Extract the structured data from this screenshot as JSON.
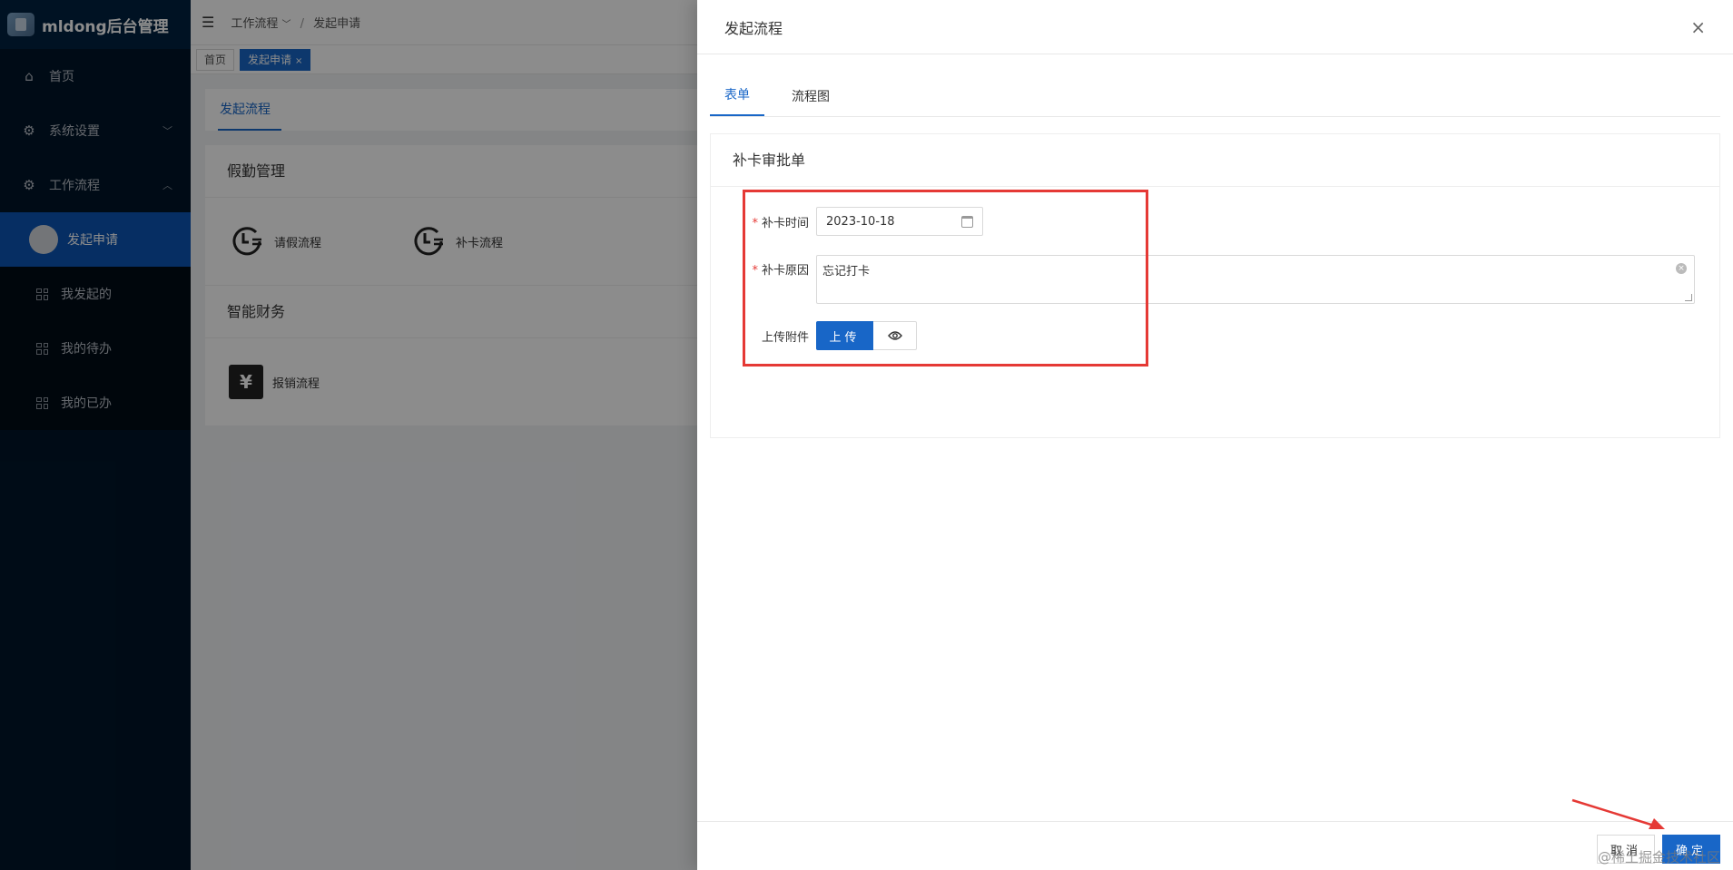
{
  "app": {
    "title": "mldong后台管理"
  },
  "sidebar": {
    "items": [
      {
        "label": "首页",
        "icon": "home-icon"
      },
      {
        "label": "系统设置",
        "icon": "gear-icon"
      },
      {
        "label": "工作流程",
        "icon": "gear-icon"
      }
    ],
    "submenu": [
      {
        "label": "发起申请",
        "active": true
      },
      {
        "label": "我发起的"
      },
      {
        "label": "我的待办"
      },
      {
        "label": "我的已办"
      }
    ]
  },
  "header": {
    "breadcrumb": [
      "工作流程",
      "发起申请"
    ]
  },
  "tags": [
    {
      "label": "首页"
    },
    {
      "label": "发起申请",
      "active": true,
      "close": "×"
    }
  ],
  "main": {
    "tab": "发起流程",
    "sections": [
      {
        "title": "假勤管理",
        "items": [
          "请假流程",
          "补卡流程"
        ]
      },
      {
        "title": "智能财务",
        "items": [
          "报销流程"
        ]
      }
    ],
    "yen_symbol": "¥"
  },
  "drawer": {
    "title": "发起流程",
    "close": "×",
    "tabs": [
      "表单",
      "流程图"
    ],
    "form": {
      "title": "补卡审批单",
      "time_label": "补卡时间",
      "time_value": "2023-10-18",
      "reason_label": "补卡原因",
      "reason_value": "忘记打卡",
      "attach_label": "上传附件",
      "upload_label": "上传",
      "required_mark": "*"
    },
    "footer": {
      "cancel": "取消",
      "ok": "确定"
    }
  },
  "watermark": "@稀土掘金技术社区",
  "colors": {
    "primary": "#1866c7",
    "sidebar": "#001529",
    "highlight": "#e53935"
  }
}
